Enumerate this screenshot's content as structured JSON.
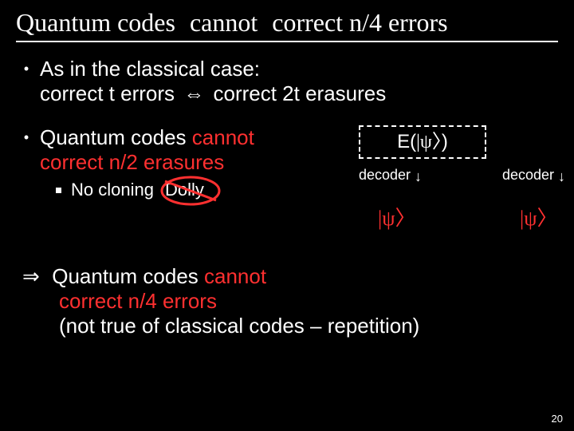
{
  "title": {
    "part1": "Quantum codes",
    "part2": "cannot",
    "part3": "correct n/4 errors"
  },
  "bullet1": {
    "line1": "As in the classical case:",
    "line2a": "correct t errors",
    "arrow": "⇔",
    "line2b": "correct 2t erasures"
  },
  "bullet2": {
    "line1a": "Quantum codes ",
    "line1b": "cannot",
    "line2": "correct n/2 erasures",
    "sub_label": "No cloning",
    "dolly": "Dolly"
  },
  "diagram": {
    "E": "E(",
    "psi_open": "|",
    "psi_sym": "ψ",
    "psi_close": "〉",
    "close_paren": ")",
    "decoder": "decoder"
  },
  "conclusion": {
    "implies": "⇒",
    "line1a": "Quantum codes ",
    "line1b": "cannot",
    "line2": "correct n/4 errors",
    "line3": "(not true of classical codes – repetition)"
  },
  "page_number": "20"
}
